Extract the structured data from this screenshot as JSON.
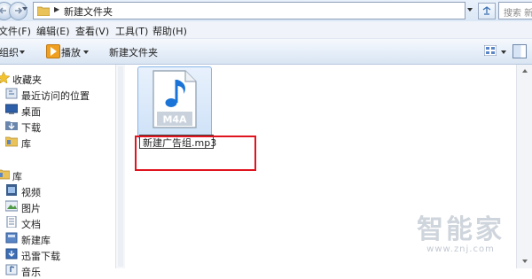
{
  "address_bar": {
    "path": "新建文件夹",
    "search_placeholder": "搜索 新建文件夹"
  },
  "menu": [
    "文件(F)",
    "编辑(E)",
    "查看(V)",
    "工具(T)",
    "帮助(H)"
  ],
  "toolbar": {
    "organize": "组织",
    "play": "播放",
    "new_folder": "新建文件夹"
  },
  "nav": {
    "favorites_header": "收藏夹",
    "favorites": [
      "最近访问的位置",
      "桌面",
      "下载",
      "库"
    ],
    "libraries_header": "库",
    "libraries": [
      "视频",
      "图片",
      "文档",
      "新建库",
      "迅雷下载",
      "音乐"
    ]
  },
  "file": {
    "icon_label": "M4A",
    "rename_value": "新建广告组.mp3"
  },
  "watermark": {
    "text": "智能家",
    "url": "www.znj.com"
  },
  "colors": {
    "highlight_rect": "#e0141e",
    "selection": "#cfe2f8",
    "note_icon": "#1a73d6"
  }
}
